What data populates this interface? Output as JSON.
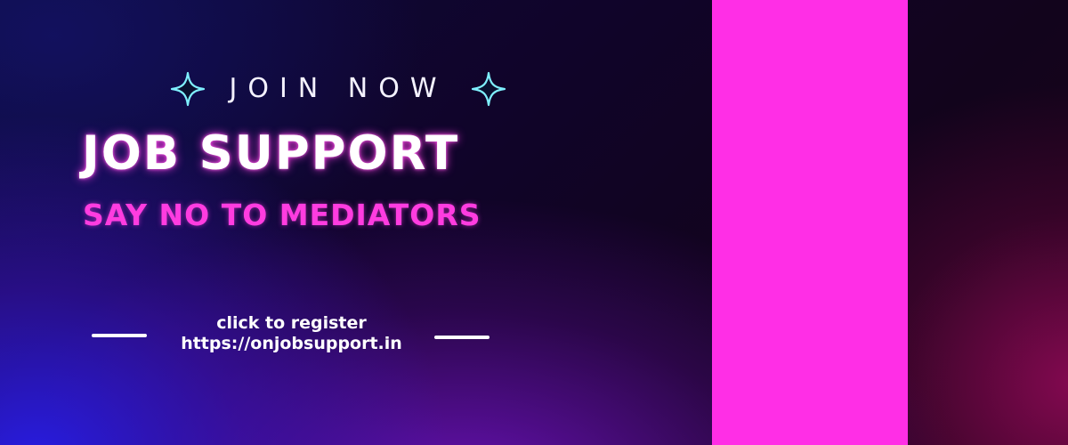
{
  "banner": {
    "join_label": "JOIN NOW",
    "headline": "JOB SUPPORT",
    "subline": "SAY NO TO MEDIATORS",
    "cta_line1": "click to register",
    "cta_line2": "https://onjobsupport.in"
  },
  "icons": {
    "left_sparkle": "sparkle-icon",
    "right_sparkle": "sparkle-icon"
  },
  "colors": {
    "accent_pink": "#ff2ee6",
    "subline_pink": "#ff3ce0",
    "sparkle_glow": "#5fe8ff",
    "text_white": "#ffffff"
  }
}
